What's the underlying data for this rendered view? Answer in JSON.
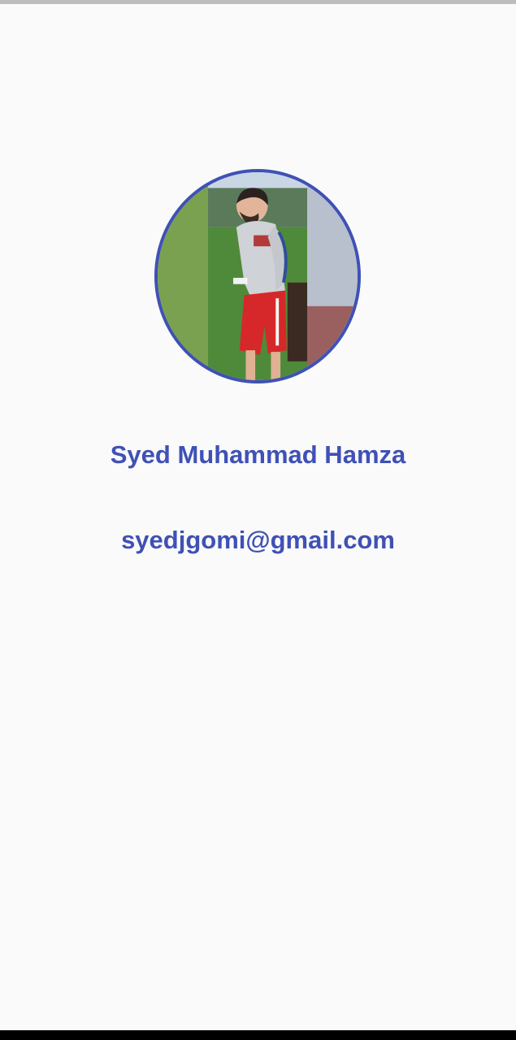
{
  "profile": {
    "name": "Syed Muhammad Hamza",
    "email": "syedjgomi@gmail.com",
    "avatar_icon": "profile-photo"
  },
  "colors": {
    "accent": "#3f51b5",
    "background": "#fafafa"
  }
}
